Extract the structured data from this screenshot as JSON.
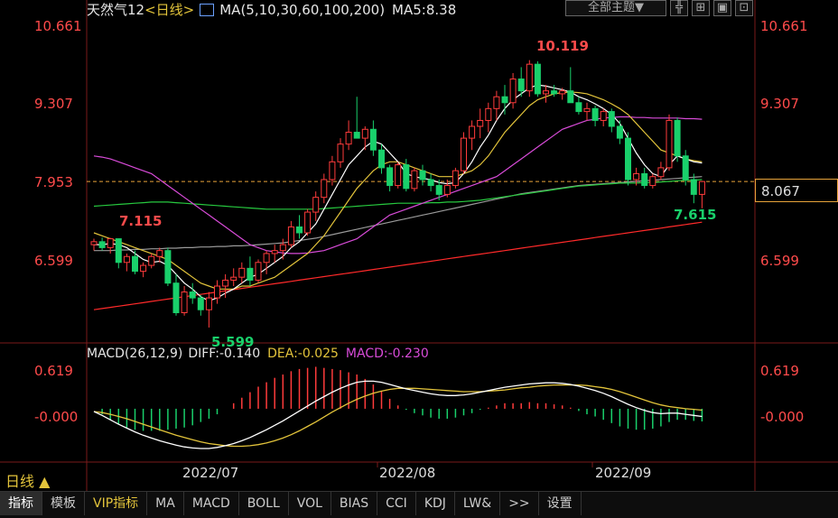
{
  "header": {
    "symbol": "天然气12",
    "period_tag": "<日线>",
    "ma_label": "MA(5,10,30,60,100,200)",
    "ma5_label": "MA5:8.38",
    "theme_button": "全部主题▼"
  },
  "price_axis": {
    "labels": [
      "10.661",
      "9.307",
      "7.953",
      "6.599"
    ],
    "current_price": "8.067"
  },
  "annotations": {
    "high_left": "7.115",
    "low": "5.599",
    "high": "10.119",
    "recent_low": "7.615"
  },
  "macd_header": {
    "name": "MACD(26,12,9)",
    "diff": "DIFF:-0.140",
    "dea": "DEA:-0.025",
    "macd": "MACD:-0.230"
  },
  "macd_axis": {
    "labels": [
      "0.619",
      "-0.000"
    ]
  },
  "date_labels": [
    "2022/07",
    "2022/08",
    "2022/09"
  ],
  "period_button": "日线 ▲",
  "tabs": [
    "指标",
    "模板",
    "VIP指标",
    "MA",
    "MACD",
    "BOLL",
    "VOL",
    "BIAS",
    "CCI",
    "KDJ",
    "LW&",
    ">>",
    "设置"
  ],
  "colors": {
    "up": "#ff3b3b",
    "down": "#19d06b",
    "ma5": "#ffffff",
    "ma10": "#e3c43b",
    "ma30": "#d84bd8",
    "ma60": "#27c93f",
    "ma100": "#9a9a9a",
    "ma200": "#ff2a2a"
  },
  "chart_data": {
    "type": "candlestick",
    "ylim": [
      5.4,
      10.8
    ],
    "candles": [
      [
        7.0,
        7.1,
        6.9,
        7.05
      ],
      [
        7.05,
        7.12,
        6.9,
        6.95
      ],
      [
        6.95,
        7.115,
        6.85,
        7.1
      ],
      [
        7.1,
        7.1,
        6.6,
        6.7
      ],
      [
        6.7,
        6.85,
        6.55,
        6.8
      ],
      [
        6.8,
        6.9,
        6.5,
        6.55
      ],
      [
        6.55,
        6.7,
        6.45,
        6.65
      ],
      [
        6.65,
        6.85,
        6.6,
        6.8
      ],
      [
        6.8,
        6.95,
        6.7,
        6.9
      ],
      [
        6.9,
        6.95,
        6.3,
        6.35
      ],
      [
        6.35,
        6.5,
        5.8,
        5.85
      ],
      [
        5.85,
        6.3,
        5.8,
        6.2
      ],
      [
        6.2,
        6.35,
        6.0,
        6.1
      ],
      [
        6.1,
        6.15,
        5.8,
        5.9
      ],
      [
        5.9,
        6.2,
        5.599,
        6.1
      ],
      [
        6.1,
        6.4,
        6.0,
        6.3
      ],
      [
        6.3,
        6.5,
        6.1,
        6.4
      ],
      [
        6.4,
        6.6,
        6.3,
        6.45
      ],
      [
        6.45,
        6.7,
        6.35,
        6.6
      ],
      [
        6.6,
        6.8,
        6.3,
        6.4
      ],
      [
        6.4,
        6.75,
        6.35,
        6.7
      ],
      [
        6.7,
        6.9,
        6.5,
        6.85
      ],
      [
        6.85,
        7.0,
        6.7,
        6.9
      ],
      [
        6.9,
        7.1,
        6.75,
        7.0
      ],
      [
        7.0,
        7.4,
        6.95,
        7.3
      ],
      [
        7.3,
        7.5,
        7.1,
        7.2
      ],
      [
        7.2,
        7.6,
        7.15,
        7.55
      ],
      [
        7.55,
        7.9,
        7.4,
        7.8
      ],
      [
        7.8,
        8.2,
        7.7,
        8.1
      ],
      [
        8.1,
        8.5,
        8.0,
        8.4
      ],
      [
        8.4,
        8.8,
        8.3,
        8.7
      ],
      [
        8.7,
        9.1,
        8.6,
        8.9
      ],
      [
        8.9,
        9.5,
        8.8,
        8.8
      ],
      [
        8.8,
        9.0,
        8.6,
        8.95
      ],
      [
        8.95,
        9.1,
        8.5,
        8.6
      ],
      [
        8.6,
        8.7,
        8.2,
        8.3
      ],
      [
        8.3,
        8.35,
        7.9,
        8.0
      ],
      [
        8.0,
        8.4,
        7.95,
        8.35
      ],
      [
        8.35,
        8.45,
        7.9,
        7.95
      ],
      [
        7.95,
        8.3,
        7.9,
        8.25
      ],
      [
        8.25,
        8.35,
        8.0,
        8.1
      ],
      [
        8.1,
        8.2,
        7.9,
        8.0
      ],
      [
        8.0,
        8.1,
        7.75,
        7.85
      ],
      [
        7.85,
        8.1,
        7.8,
        8.0
      ],
      [
        8.0,
        8.3,
        7.95,
        8.25
      ],
      [
        8.25,
        8.9,
        8.2,
        8.8
      ],
      [
        8.8,
        9.1,
        8.6,
        9.0
      ],
      [
        9.0,
        9.3,
        8.8,
        9.1
      ],
      [
        9.1,
        9.4,
        8.9,
        9.3
      ],
      [
        9.3,
        9.6,
        9.1,
        9.5
      ],
      [
        9.5,
        9.7,
        9.2,
        9.4
      ],
      [
        9.4,
        9.9,
        9.3,
        9.8
      ],
      [
        9.8,
        10.0,
        9.5,
        9.6
      ],
      [
        9.6,
        10.119,
        9.5,
        10.05
      ],
      [
        10.05,
        10.1,
        9.5,
        9.55
      ],
      [
        9.55,
        9.7,
        9.4,
        9.6
      ],
      [
        9.6,
        9.7,
        9.5,
        9.55
      ],
      [
        9.55,
        9.65,
        9.45,
        9.6
      ],
      [
        9.6,
        10.0,
        9.4,
        9.4
      ],
      [
        9.4,
        9.5,
        9.2,
        9.25
      ],
      [
        9.25,
        9.4,
        9.1,
        9.3
      ],
      [
        9.3,
        9.35,
        9.0,
        9.1
      ],
      [
        9.1,
        9.3,
        9.0,
        9.25
      ],
      [
        9.25,
        9.3,
        8.9,
        9.0
      ],
      [
        9.0,
        9.1,
        8.7,
        8.8
      ],
      [
        8.8,
        8.9,
        8.0,
        8.1
      ],
      [
        8.1,
        8.3,
        8.0,
        8.2
      ],
      [
        8.2,
        8.3,
        7.95,
        8.0
      ],
      [
        8.0,
        8.2,
        7.95,
        8.15
      ],
      [
        8.15,
        8.4,
        8.1,
        8.3
      ],
      [
        8.3,
        9.2,
        8.25,
        9.1
      ],
      [
        9.1,
        9.15,
        8.4,
        8.5
      ],
      [
        8.5,
        8.6,
        8.0,
        8.1
      ],
      [
        8.1,
        8.2,
        7.7,
        7.85
      ],
      [
        7.85,
        8.067,
        7.615,
        8.067
      ]
    ],
    "ma": {
      "ma5": [
        7.0,
        7.0,
        7.02,
        7.0,
        6.95,
        6.85,
        6.75,
        6.7,
        6.72,
        6.65,
        6.5,
        6.35,
        6.25,
        6.12,
        6.05,
        6.1,
        6.18,
        6.25,
        6.35,
        6.45,
        6.5,
        6.6,
        6.7,
        6.8,
        6.95,
        7.05,
        7.2,
        7.35,
        7.6,
        7.85,
        8.1,
        8.35,
        8.5,
        8.65,
        8.75,
        8.7,
        8.55,
        8.4,
        8.2,
        8.15,
        8.12,
        8.1,
        8.05,
        8.03,
        8.05,
        8.2,
        8.4,
        8.65,
        8.85,
        9.1,
        9.3,
        9.45,
        9.55,
        9.65,
        9.7,
        9.68,
        9.65,
        9.62,
        9.58,
        9.5,
        9.45,
        9.38,
        9.3,
        9.2,
        9.05,
        8.8,
        8.55,
        8.35,
        8.2,
        8.15,
        8.35,
        8.5,
        8.45,
        8.4,
        8.38
      ],
      "ma10": [
        7.2,
        7.15,
        7.1,
        7.05,
        7.0,
        6.95,
        6.9,
        6.85,
        6.8,
        6.75,
        6.65,
        6.55,
        6.45,
        6.35,
        6.3,
        6.25,
        6.25,
        6.25,
        6.3,
        6.3,
        6.35,
        6.4,
        6.45,
        6.55,
        6.65,
        6.75,
        6.85,
        7.0,
        7.15,
        7.35,
        7.55,
        7.75,
        7.95,
        8.1,
        8.25,
        8.35,
        8.4,
        8.4,
        8.35,
        8.3,
        8.25,
        8.2,
        8.15,
        8.15,
        8.15,
        8.2,
        8.25,
        8.35,
        8.5,
        8.7,
        8.9,
        9.05,
        9.2,
        9.35,
        9.45,
        9.5,
        9.55,
        9.57,
        9.58,
        9.57,
        9.55,
        9.5,
        9.45,
        9.38,
        9.3,
        9.2,
        9.05,
        8.9,
        8.75,
        8.6,
        8.55,
        8.5,
        8.45,
        8.42,
        8.4
      ],
      "ma30": [
        8.5,
        8.48,
        8.45,
        8.4,
        8.35,
        8.3,
        8.25,
        8.2,
        8.1,
        8.0,
        7.9,
        7.8,
        7.7,
        7.6,
        7.5,
        7.4,
        7.3,
        7.2,
        7.1,
        7.0,
        6.95,
        6.9,
        6.88,
        6.86,
        6.85,
        6.85,
        6.86,
        6.88,
        6.9,
        6.95,
        7.0,
        7.05,
        7.1,
        7.2,
        7.3,
        7.4,
        7.5,
        7.55,
        7.6,
        7.65,
        7.7,
        7.75,
        7.8,
        7.85,
        7.9,
        7.95,
        8.0,
        8.05,
        8.1,
        8.15,
        8.25,
        8.35,
        8.45,
        8.55,
        8.65,
        8.75,
        8.85,
        8.95,
        9.0,
        9.05,
        9.1,
        9.12,
        9.14,
        9.15,
        9.16,
        9.16,
        9.15,
        9.15,
        9.14,
        9.14,
        9.14,
        9.14,
        9.13,
        9.13,
        9.12
      ],
      "ma60": [
        7.65,
        7.66,
        7.67,
        7.68,
        7.69,
        7.7,
        7.71,
        7.72,
        7.72,
        7.72,
        7.71,
        7.7,
        7.69,
        7.68,
        7.67,
        7.66,
        7.65,
        7.64,
        7.63,
        7.62,
        7.61,
        7.6,
        7.6,
        7.6,
        7.6,
        7.6,
        7.6,
        7.6,
        7.61,
        7.62,
        7.63,
        7.64,
        7.65,
        7.66,
        7.67,
        7.68,
        7.69,
        7.7,
        7.7,
        7.7,
        7.7,
        7.71,
        7.71,
        7.72,
        7.72,
        7.73,
        7.74,
        7.75,
        7.77,
        7.79,
        7.81,
        7.83,
        7.85,
        7.87,
        7.89,
        7.91,
        7.93,
        7.95,
        7.97,
        7.99,
        8.0,
        8.01,
        8.02,
        8.03,
        8.04,
        8.04,
        8.04,
        8.05,
        8.05,
        8.06,
        8.07,
        8.08,
        8.09,
        8.09,
        8.1
      ],
      "ma100": [
        6.9,
        6.9,
        6.9,
        6.91,
        6.91,
        6.92,
        6.92,
        6.93,
        6.93,
        6.94,
        6.94,
        6.95,
        6.95,
        6.96,
        6.96,
        6.97,
        6.97,
        6.98,
        6.98,
        6.99,
        7.0,
        7.01,
        7.02,
        7.03,
        7.05,
        7.07,
        7.09,
        7.11,
        7.14,
        7.17,
        7.2,
        7.23,
        7.26,
        7.29,
        7.32,
        7.35,
        7.38,
        7.41,
        7.44,
        7.47,
        7.5,
        7.53,
        7.56,
        7.59,
        7.62,
        7.65,
        7.68,
        7.71,
        7.74,
        7.77,
        7.8,
        7.83,
        7.86,
        7.88,
        7.9,
        7.92,
        7.94,
        7.96,
        7.98,
        8.0,
        8.01,
        8.02,
        8.03,
        8.04,
        8.05,
        8.06,
        8.07,
        8.08,
        8.09,
        8.1,
        8.11,
        8.12,
        8.13,
        8.14,
        8.15
      ],
      "ma200": [
        5.9,
        5.92,
        5.94,
        5.96,
        5.98,
        6.0,
        6.02,
        6.04,
        6.06,
        6.08,
        6.1,
        6.12,
        6.14,
        6.16,
        6.18,
        6.2,
        6.22,
        6.24,
        6.26,
        6.28,
        6.3,
        6.32,
        6.34,
        6.36,
        6.38,
        6.4,
        6.42,
        6.44,
        6.46,
        6.48,
        6.5,
        6.52,
        6.54,
        6.56,
        6.58,
        6.6,
        6.62,
        6.64,
        6.66,
        6.68,
        6.7,
        6.72,
        6.74,
        6.76,
        6.78,
        6.8,
        6.82,
        6.84,
        6.86,
        6.88,
        6.9,
        6.92,
        6.94,
        6.96,
        6.98,
        7.0,
        7.02,
        7.04,
        7.06,
        7.08,
        7.1,
        7.12,
        7.14,
        7.16,
        7.18,
        7.2,
        7.22,
        7.24,
        7.26,
        7.28,
        7.3,
        7.32,
        7.34,
        7.36,
        7.38
      ]
    },
    "macd": {
      "ylim": [
        -0.9,
        0.8
      ],
      "diff": [
        -0.05,
        -0.12,
        -0.2,
        -0.28,
        -0.35,
        -0.42,
        -0.48,
        -0.53,
        -0.58,
        -0.62,
        -0.66,
        -0.69,
        -0.71,
        -0.72,
        -0.72,
        -0.7,
        -0.67,
        -0.63,
        -0.58,
        -0.52,
        -0.45,
        -0.38,
        -0.3,
        -0.22,
        -0.13,
        -0.04,
        0.05,
        0.14,
        0.22,
        0.3,
        0.37,
        0.43,
        0.48,
        0.5,
        0.5,
        0.48,
        0.44,
        0.4,
        0.36,
        0.33,
        0.3,
        0.27,
        0.25,
        0.24,
        0.24,
        0.25,
        0.27,
        0.3,
        0.33,
        0.36,
        0.39,
        0.41,
        0.43,
        0.45,
        0.46,
        0.47,
        0.47,
        0.46,
        0.44,
        0.41,
        0.37,
        0.33,
        0.28,
        0.22,
        0.15,
        0.08,
        0.02,
        -0.03,
        -0.07,
        -0.09,
        -0.08,
        -0.08,
        -0.1,
        -0.12,
        -0.14
      ],
      "dea": [
        -0.05,
        -0.07,
        -0.1,
        -0.14,
        -0.18,
        -0.23,
        -0.28,
        -0.33,
        -0.38,
        -0.43,
        -0.48,
        -0.52,
        -0.56,
        -0.6,
        -0.63,
        -0.65,
        -0.67,
        -0.68,
        -0.68,
        -0.67,
        -0.65,
        -0.62,
        -0.58,
        -0.53,
        -0.47,
        -0.4,
        -0.32,
        -0.24,
        -0.15,
        -0.06,
        0.02,
        0.1,
        0.17,
        0.23,
        0.28,
        0.32,
        0.35,
        0.37,
        0.37,
        0.37,
        0.36,
        0.35,
        0.34,
        0.33,
        0.32,
        0.31,
        0.31,
        0.31,
        0.32,
        0.33,
        0.34,
        0.36,
        0.38,
        0.39,
        0.41,
        0.42,
        0.43,
        0.43,
        0.43,
        0.43,
        0.42,
        0.4,
        0.38,
        0.35,
        0.31,
        0.26,
        0.21,
        0.16,
        0.11,
        0.07,
        0.04,
        0.02,
        0.0,
        -0.01,
        -0.025
      ],
      "hist": [
        0.0,
        -0.1,
        -0.2,
        -0.28,
        -0.34,
        -0.38,
        -0.4,
        -0.4,
        -0.4,
        -0.38,
        -0.36,
        -0.34,
        -0.3,
        -0.24,
        -0.18,
        -0.1,
        0.0,
        0.1,
        0.2,
        0.3,
        0.4,
        0.48,
        0.56,
        0.62,
        0.68,
        0.72,
        0.74,
        0.76,
        0.74,
        0.72,
        0.7,
        0.66,
        0.62,
        0.54,
        0.44,
        0.32,
        0.18,
        0.06,
        -0.02,
        -0.08,
        -0.12,
        -0.16,
        -0.18,
        -0.18,
        -0.16,
        -0.12,
        -0.08,
        -0.02,
        0.02,
        0.06,
        0.1,
        0.1,
        0.1,
        0.12,
        0.1,
        0.1,
        0.08,
        0.06,
        0.02,
        -0.04,
        -0.1,
        -0.14,
        -0.2,
        -0.26,
        -0.32,
        -0.36,
        -0.38,
        -0.38,
        -0.36,
        -0.32,
        -0.24,
        -0.2,
        -0.2,
        -0.22,
        -0.23
      ]
    }
  }
}
